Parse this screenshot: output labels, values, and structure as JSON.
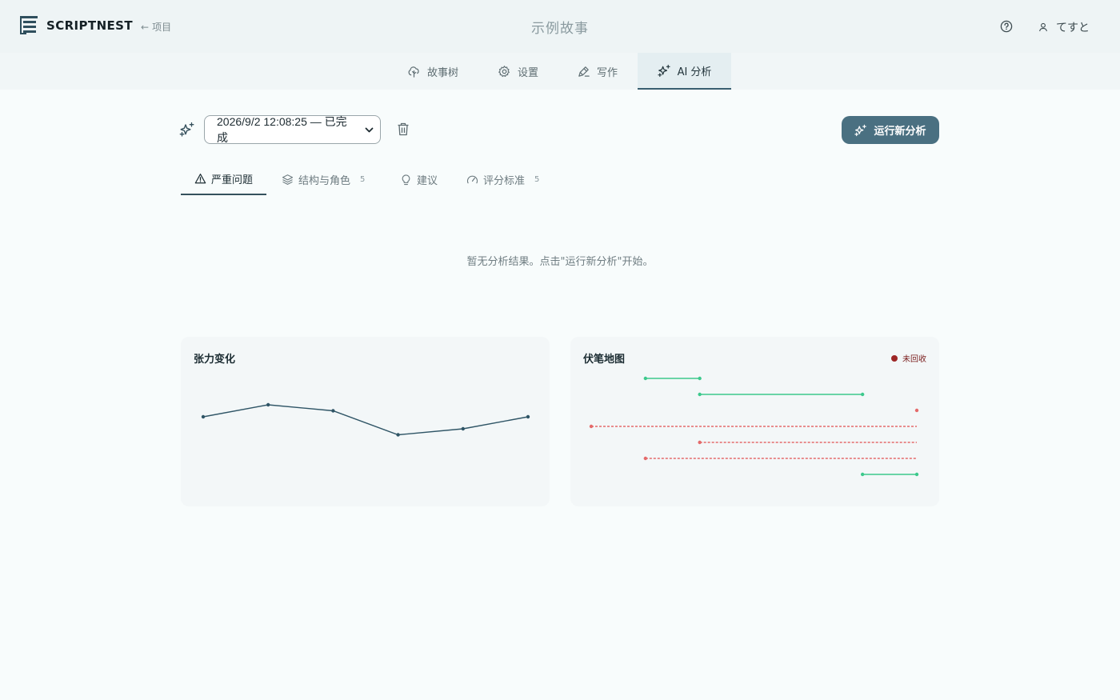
{
  "app": {
    "brand": "SCRIPTNEST",
    "back_label": "项目",
    "story_title": "示例故事",
    "user_name": "てすと"
  },
  "nav": {
    "tabs": [
      {
        "label": "故事树",
        "icon": "tree-icon"
      },
      {
        "label": "设置",
        "icon": "gear-icon"
      },
      {
        "label": "写作",
        "icon": "pen-icon"
      },
      {
        "label": "AI 分析",
        "icon": "sparkles-icon",
        "active": true
      }
    ]
  },
  "toolbar": {
    "run_selected": "2026/9/2 12:08:25 — 已完成",
    "run_button": "运行新分析"
  },
  "subtabs": [
    {
      "label": "严重问题",
      "count": "",
      "icon": "warning-icon",
      "active": true
    },
    {
      "label": "结构与角色",
      "count": "5",
      "icon": "layers-icon"
    },
    {
      "label": "建议",
      "count": "",
      "icon": "lightbulb-icon"
    },
    {
      "label": "评分标准",
      "count": "5",
      "icon": "gauge-icon"
    }
  ],
  "empty_message": "暂无分析结果。点击\"运行新分析\"开始。",
  "colors": {
    "accent": "#4a7081",
    "tension_line": "#2f5566",
    "resolved": "#3cc98c",
    "unresolved": "#e46a6a",
    "legend_unresolved": "#9d2626"
  },
  "chart_data": [
    {
      "type": "line",
      "title": "张力变化",
      "x": [
        1,
        2,
        3,
        4,
        5,
        6
      ],
      "series": [
        {
          "values": [
            0.6,
            0.7,
            0.65,
            0.45,
            0.5,
            0.6
          ]
        }
      ],
      "ylim": [
        0,
        1
      ],
      "grid": false,
      "legend": "none"
    },
    {
      "type": "timeline",
      "title": "伏笔地图",
      "legend": [
        {
          "label": "未回收",
          "color": "#9d2626"
        }
      ],
      "xlim": [
        0,
        6
      ],
      "threads": [
        {
          "start": 1,
          "end": 2,
          "resolved": true
        },
        {
          "start": 2,
          "end": 5,
          "resolved": true
        },
        {
          "start": 6,
          "end": 6,
          "resolved": false
        },
        {
          "start": 0,
          "end": 6,
          "resolved": false
        },
        {
          "start": 2,
          "end": 6,
          "resolved": false
        },
        {
          "start": 1,
          "end": 6,
          "resolved": false
        },
        {
          "start": 5,
          "end": 6,
          "resolved": true
        }
      ]
    }
  ]
}
